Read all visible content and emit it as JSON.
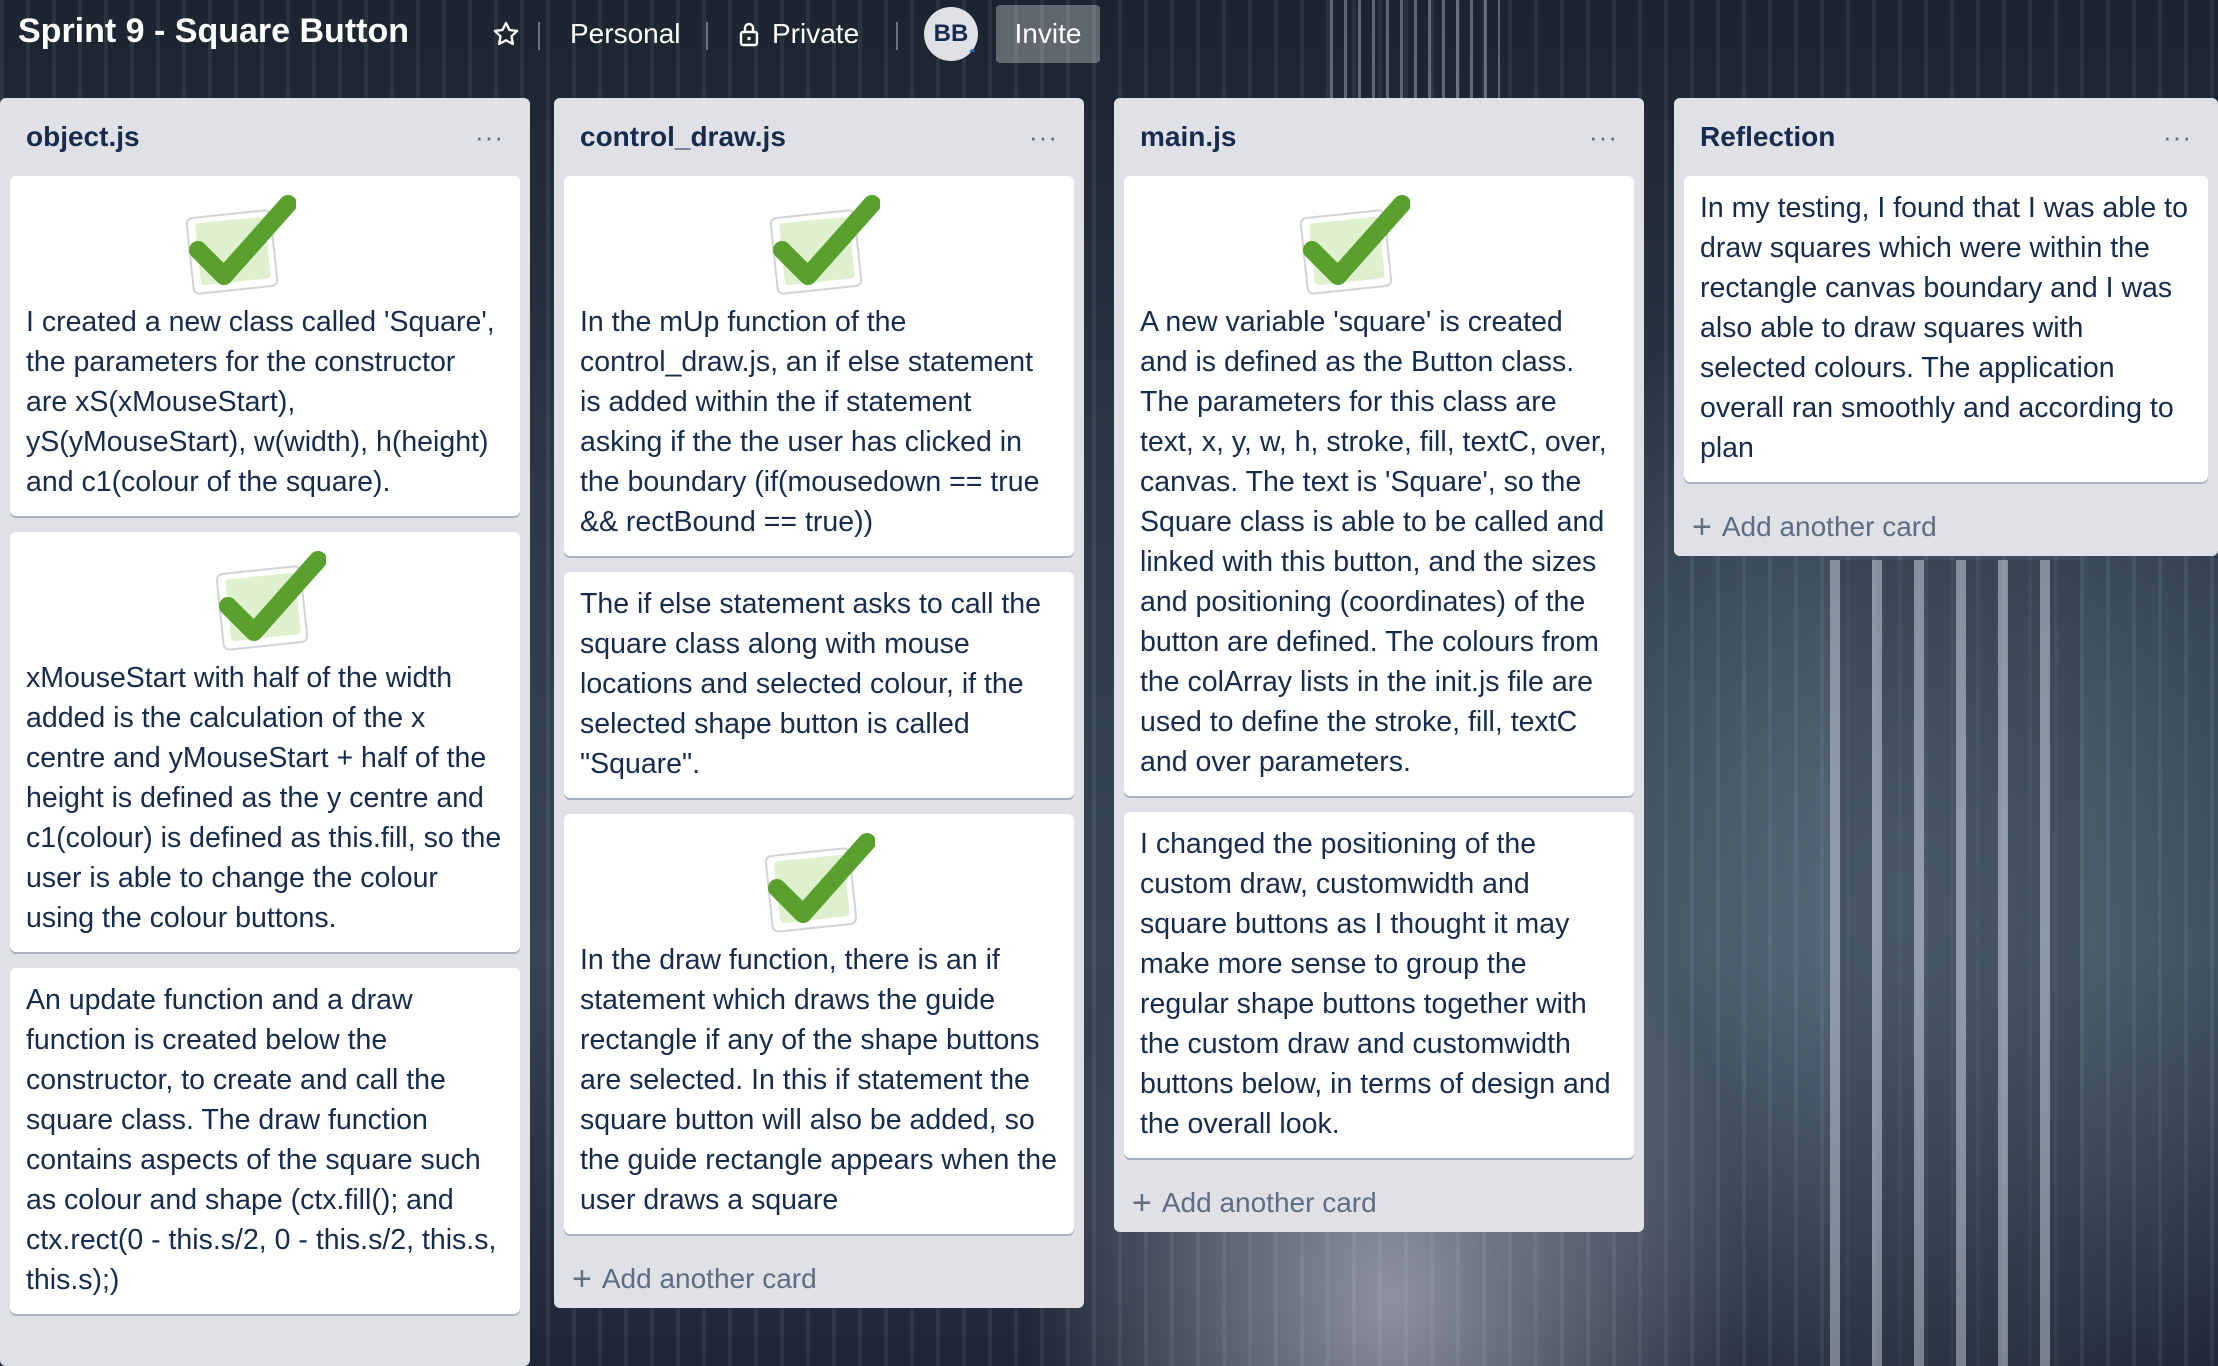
{
  "board": {
    "title": "Sprint 9 - Square Button",
    "star_icon": "star-icon",
    "visibility_team": "Personal",
    "visibility_private": "Private",
    "lock_icon": "lock-icon",
    "member_initials": "BB",
    "invite_label": "Invite"
  },
  "lists": [
    {
      "title": "object.js",
      "menu": "···",
      "cards": [
        {
          "check": true,
          "text": "I created a new class called 'Square', the parameters for the constructor are xS(xMouseStart), yS(yMouseStart), w(width), h(height) and c1(colour of the square)."
        },
        {
          "check": true,
          "text": "xMouseStart with half of the width added is the calculation of the x centre and yMouseStart + half of the height is defined as the y centre and c1(colour) is defined as this.fill, so the user is able to change the colour using the colour buttons."
        },
        {
          "check": false,
          "text": "An update function and a draw function is created below the constructor, to create and call the square class. The draw function contains aspects of the square such as colour and shape (ctx.fill(); and ctx.rect(0 - this.s/2, 0 - this.s/2, this.s, this.s);)"
        }
      ]
    },
    {
      "title": "control_draw.js",
      "menu": "···",
      "cards": [
        {
          "check": true,
          "text": "In the mUp function of the control_draw.js, an if else statement is added within the if statement asking if the the user has clicked in the boundary (if(mousedown == true && rectBound == true))"
        },
        {
          "check": false,
          "text": "The if else statement asks to call the square class along with mouse locations and selected colour, if the selected shape button is called \"Square\"."
        },
        {
          "check": true,
          "text": "In the draw function, there is an if statement which draws the guide rectangle if any of the shape buttons are selected. In this if statement the square button will also be added, so the guide rectangle appears when the user draws a square"
        }
      ],
      "add_label": "Add another card"
    },
    {
      "title": "main.js",
      "menu": "···",
      "cards": [
        {
          "check": true,
          "text": "A new variable 'square' is created and is defined as the Button class. The parameters for this class are text, x, y, w, h, stroke, fill, textC, over, canvas. The text is 'Square', so the Square class is able to be called and linked with this button, and the sizes and positioning (coordinates) of the button are defined. The colours from the colArray lists in the init.js file are used to define the stroke, fill, textC and over parameters."
        },
        {
          "check": false,
          "text": "I changed the positioning of the custom draw, customwidth and square buttons as I thought it may make more sense to group the regular shape buttons together with the custom draw and customwidth buttons below, in terms of design and the overall look."
        }
      ],
      "add_label": "Add another card"
    },
    {
      "title": "Reflection",
      "menu": "···",
      "cards": [
        {
          "check": false,
          "text": "In my testing, I found that I was able to draw squares which were within the rectangle canvas boundary and I was also able to draw squares with selected colours. The application overall ran smoothly and according to plan"
        }
      ],
      "add_label": "Add another card"
    }
  ],
  "colors": {
    "list_bg": "#dfe1e6",
    "card_bg": "#ffffff",
    "text": "#172b4d",
    "muted": "#5e6c84",
    "check_green": "#5aa02c"
  }
}
